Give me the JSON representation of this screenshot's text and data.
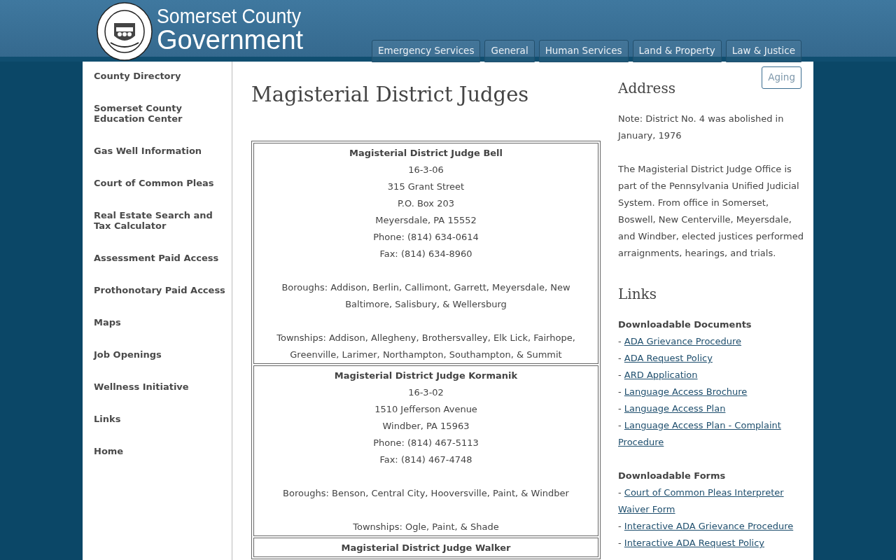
{
  "site": {
    "title_top": "Somerset County",
    "title_bottom": "Government"
  },
  "tabs": [
    {
      "label": "Emergency Services"
    },
    {
      "label": "General"
    },
    {
      "label": "Human Services"
    },
    {
      "label": "Land & Property"
    },
    {
      "label": "Law & Justice"
    },
    {
      "label": "Aging"
    }
  ],
  "sidebar": {
    "items": [
      {
        "label": "County Directory"
      },
      {
        "label": "Somerset County Education Center"
      },
      {
        "label": "Gas Well Information"
      },
      {
        "label": "Court of Common Pleas"
      },
      {
        "label": "Real Estate Search and Tax Calculator"
      },
      {
        "label": "Assessment Paid Access"
      },
      {
        "label": "Prothonotary Paid Access"
      },
      {
        "label": "Maps"
      },
      {
        "label": "Job Openings"
      },
      {
        "label": "Wellness Initiative"
      },
      {
        "label": "Links"
      },
      {
        "label": "Home"
      }
    ]
  },
  "page_title": "Magisterial District Judges",
  "judges": [
    {
      "name": "Magisterial District Judge Bell",
      "lines": [
        "16-3-06",
        "315 Grant Street",
        "P.O. Box 203",
        "Meyersdale, PA 15552",
        "Phone: (814) 634-0614",
        "Fax: (814) 634-8960"
      ],
      "boroughs": "Boroughs: Addison, Berlin, Callimont, Garrett, Meyersdale, New Baltimore, Salisbury, & Wellersburg",
      "townships": "Townships: Addison, Allegheny, Brothersvalley, Elk Lick, Fairhope, Greenville, Larimer, Northampton, Southampton, & Summit"
    },
    {
      "name": "Magisterial District Judge Kormanik",
      "lines": [
        "16-3-02",
        "1510 Jefferson Avenue",
        "Windber, PA 15963",
        "Phone: (814) 467-5113",
        "Fax: (814) 467-4748"
      ],
      "boroughs": "Boroughs: Benson, Central City, Hooversville, Paint, & Windber",
      "townships": "Townships: Ogle, Paint, & Shade"
    },
    {
      "name": "Magisterial District Judge Walker"
    }
  ],
  "address": {
    "heading": "Address",
    "paragraphs": [
      "Note: District No. 4 was abolished in January, 1976",
      "The Magisterial District Judge Office is part of the Pennsylvania Unified Judicial System. From office in Somerset, Boswell, New Centerville, Meyersdale, and Windber, elected justices performed arraignments, hearings, and trials."
    ]
  },
  "links": {
    "heading": "Links",
    "sections": [
      {
        "heading": "Downloadable Documents",
        "items": [
          {
            "bullet": "-",
            "label": "ADA Grievance Procedure"
          },
          {
            "bullet": "-",
            "label": "ADA Request Policy"
          },
          {
            "bullet": "-",
            "label": "ARD Application"
          },
          {
            "bullet": "-",
            "label": "Language Access Brochure"
          },
          {
            "bullet": "-",
            "label": "Language Access Plan"
          },
          {
            "bullet": "-",
            "label": "Language Access Plan - Complaint Procedure"
          }
        ]
      },
      {
        "heading": "Downloadable Forms",
        "items": [
          {
            "bullet": "-",
            "label": "Court of Common Pleas Interpreter Waiver Form"
          },
          {
            "bullet": "-",
            "label": "Interactive ADA Grievance Procedure"
          },
          {
            "bullet": "-",
            "label": "Interactive ADA Request Policy"
          }
        ]
      }
    ]
  }
}
